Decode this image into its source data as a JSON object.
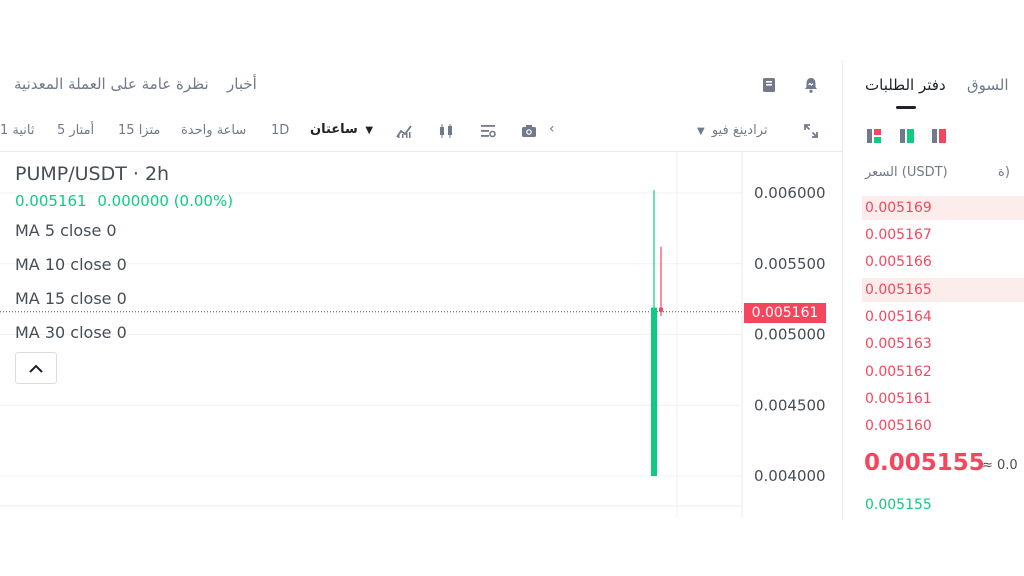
{
  "colors": {
    "up": "#0ecb81",
    "down": "#f6465d",
    "text": "#474d57",
    "muted": "#707a8a"
  },
  "top_tabs": {
    "news": "أخبار",
    "overview": "نظرة عامة على العملة المعدنية"
  },
  "toolbar": {
    "intervals": [
      "1 ثانية",
      "5 أمتار",
      "15 متزا",
      "ساعة واحدة",
      "1D"
    ],
    "selected_interval": "ساعتان",
    "tradingview": "ترادينغ فيو",
    "icons": [
      "indicator-icon",
      "candle-type-icon",
      "settings-icon",
      "camera-icon",
      "chevron-left-icon",
      "fullscreen-icon"
    ]
  },
  "chart": {
    "pair": "PUMP/USDT · 2h",
    "last_price": "0.005161",
    "change": "0.000000 (0.00%)",
    "ma": [
      "MA 5 close 0",
      "MA 10 close 0",
      "MA 15 close 0",
      "MA 30 close 0"
    ],
    "current_price_tag": "0.005161",
    "axis_labels": [
      "0.006000",
      "0.005500",
      "0.005000",
      "0.004500",
      "0.004000"
    ]
  },
  "chart_data": {
    "type": "candlestick",
    "y_ticks": [
      0.006,
      0.0055,
      0.005,
      0.0045,
      0.004
    ],
    "candles": [
      {
        "open": 0.004,
        "high": 0.00602,
        "low": 0.004,
        "close": 0.00519,
        "direction": "up"
      },
      {
        "open": 0.00519,
        "high": 0.00562,
        "low": 0.00513,
        "close": 0.005161,
        "direction": "down"
      }
    ],
    "last_price": 0.005161
  },
  "orderbook": {
    "tab_orderbook": "دفتر الطلبات",
    "tab_market": "السوق",
    "col_price": "السعر (USDT)",
    "col_partial": "ة)",
    "asks": [
      "0.005169",
      "0.005167",
      "0.005166",
      "0.005165",
      "0.005164",
      "0.005163",
      "0.005162",
      "0.005161",
      "0.005160"
    ],
    "mid_price": "0.005155",
    "mid_approx": "≈ 0.0",
    "bids": [
      "0.005155"
    ]
  }
}
